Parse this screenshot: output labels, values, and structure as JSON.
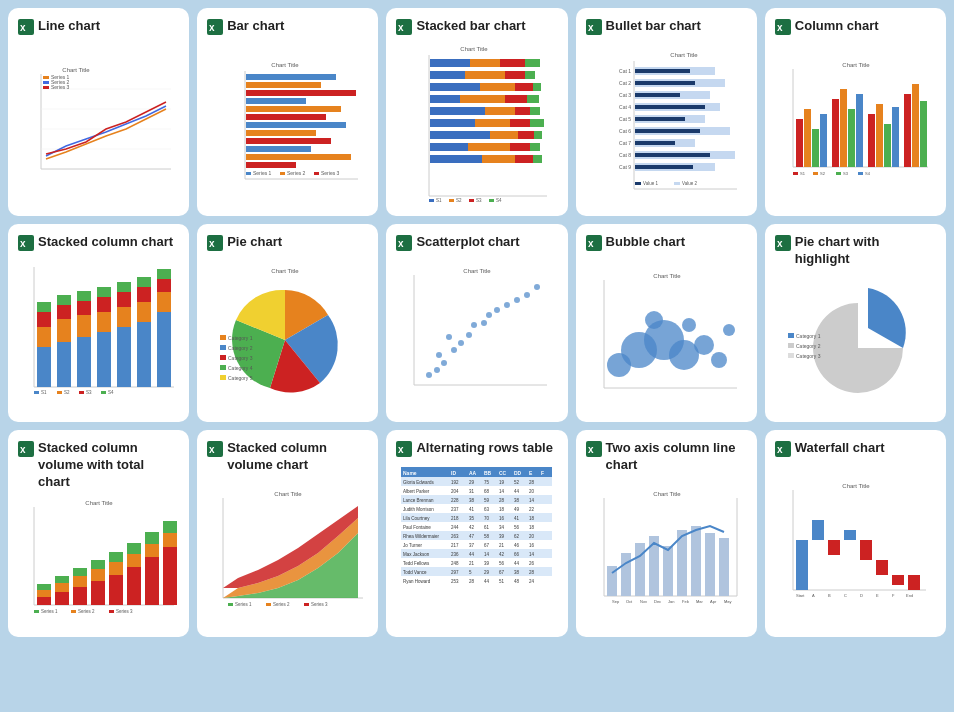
{
  "cards": [
    {
      "id": "line-chart",
      "title": "Line chart"
    },
    {
      "id": "bar-chart",
      "title": "Bar chart"
    },
    {
      "id": "stacked-bar-chart",
      "title": "Stacked bar chart"
    },
    {
      "id": "bullet-bar-chart",
      "title": "Bullet bar chart"
    },
    {
      "id": "column-chart",
      "title": "Column chart"
    },
    {
      "id": "stacked-column-chart",
      "title": "Stacked column chart"
    },
    {
      "id": "pie-chart",
      "title": "Pie chart"
    },
    {
      "id": "scatterplot-chart",
      "title": "Scatterplot chart"
    },
    {
      "id": "bubble-chart",
      "title": "Bubble chart"
    },
    {
      "id": "pie-chart-highlight",
      "title": "Pie chart with highlight"
    },
    {
      "id": "stacked-column-volume-total",
      "title": "Stacked column volume with total chart"
    },
    {
      "id": "stacked-column-volume",
      "title": "Stacked column volume chart"
    },
    {
      "id": "alternating-rows-table",
      "title": "Alternating rows table"
    },
    {
      "id": "two-axis-column-line",
      "title": "Two axis column line chart"
    },
    {
      "id": "waterfall-chart",
      "title": "Waterfall chart"
    }
  ]
}
